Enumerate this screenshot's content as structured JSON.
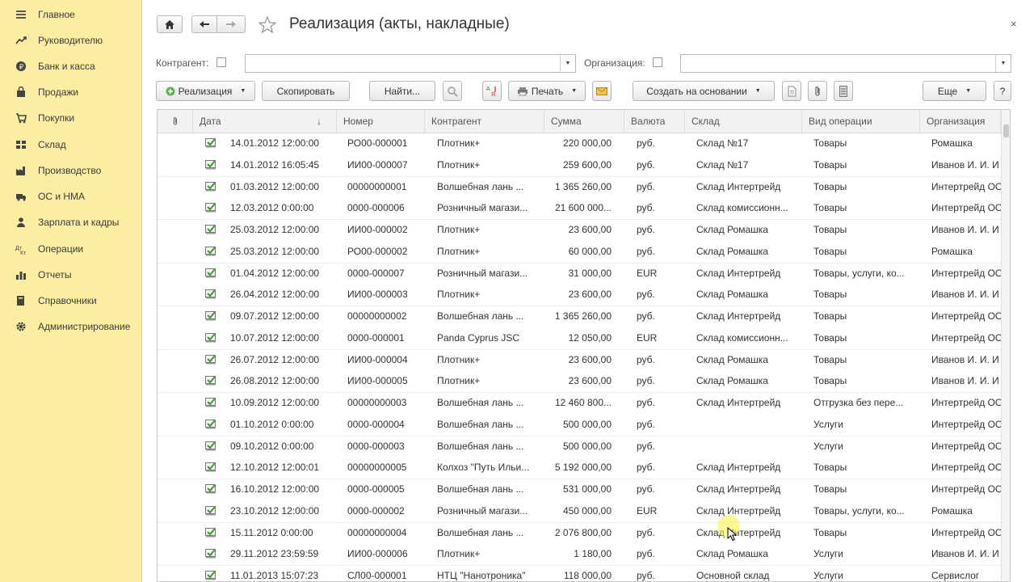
{
  "sidebar": {
    "items": [
      {
        "label": "Главное",
        "icon": "menu-icon"
      },
      {
        "label": "Руководителю",
        "icon": "trend-icon"
      },
      {
        "label": "Банк и касса",
        "icon": "coin-icon"
      },
      {
        "label": "Продажи",
        "icon": "bag-icon"
      },
      {
        "label": "Покупки",
        "icon": "cart-icon"
      },
      {
        "label": "Склад",
        "icon": "warehouse-icon"
      },
      {
        "label": "Производство",
        "icon": "factory-icon"
      },
      {
        "label": "ОС и НМА",
        "icon": "truck-icon"
      },
      {
        "label": "Зарплата и кадры",
        "icon": "person-icon"
      },
      {
        "label": "Операции",
        "icon": "operations-icon"
      },
      {
        "label": "Отчеты",
        "icon": "chart-icon"
      },
      {
        "label": "Справочники",
        "icon": "book-icon"
      },
      {
        "label": "Администрирование",
        "icon": "gear-icon"
      }
    ]
  },
  "header": {
    "title": "Реализация (акты, накладные)",
    "close": "×"
  },
  "filters": {
    "counterparty_label": "Контрагент:",
    "counterparty_value": "",
    "organization_label": "Организация:",
    "organization_value": ""
  },
  "toolbar": {
    "realization": "Реализация",
    "copy": "Скопировать",
    "find": "Найти...",
    "print": "Печать",
    "create_based": "Создать на основании",
    "more": "Еще",
    "help": "?"
  },
  "table": {
    "columns": [
      "Дата",
      "Номер",
      "Контрагент",
      "Сумма",
      "Валюта",
      "Склад",
      "Вид операции",
      "Организация"
    ],
    "sort_indicator": "↓",
    "rows": [
      [
        "14.01.2012 12:00:00",
        "РО00-000001",
        "Плотник+",
        "220 000,00",
        "руб.",
        "Склад №17",
        "Товары",
        "Ромашка"
      ],
      [
        "14.01.2012 16:05:45",
        "ИИ00-000007",
        "Плотник+",
        "259 600,00",
        "руб.",
        "Склад №17",
        "Товары",
        "Иванов И. И. И"
      ],
      [
        "01.03.2012 12:00:00",
        "00000000001",
        "Волшебная лань ...",
        "1 365 260,00",
        "руб.",
        "Склад Интертрейд",
        "Товары",
        "Интертрейд ОО"
      ],
      [
        "12.03.2012 0:00:00",
        "0000-000006",
        "Розничный магази...",
        "21 600 000...",
        "руб.",
        "Склад комиссионн...",
        "Товары",
        "Интертрейд ОО"
      ],
      [
        "25.03.2012 12:00:00",
        "ИИ00-000002",
        "Плотник+",
        "23 600,00",
        "руб.",
        "Склад Ромашка",
        "Товары",
        "Иванов И. И. И"
      ],
      [
        "25.03.2012 12:00:00",
        "РО00-000002",
        "Плотник+",
        "60 000,00",
        "руб.",
        "Склад Ромашка",
        "Товары",
        "Ромашка"
      ],
      [
        "01.04.2012 12:00:00",
        "0000-000007",
        "Розничный магази...",
        "31 000,00",
        "EUR",
        "Склад Интертрейд",
        "Товары, услуги, ко...",
        "Интертрейд ОО"
      ],
      [
        "26.04.2012 12:00:00",
        "ИИ00-000003",
        "Плотник+",
        "23 600,00",
        "руб.",
        "Склад Ромашка",
        "Товары",
        "Иванов И. И. И"
      ],
      [
        "09.07.2012 12:00:00",
        "00000000002",
        "Волшебная лань ...",
        "1 365 260,00",
        "руб.",
        "Склад Интертрейд",
        "Товары",
        "Интертрейд ОО"
      ],
      [
        "10.07.2012 12:00:00",
        "0000-000001",
        "Panda Cyprus JSC",
        "12 050,00",
        "EUR",
        "Склад комиссионн...",
        "Товары",
        "Интертрейд ОО"
      ],
      [
        "26.07.2012 12:00:00",
        "ИИ00-000004",
        "Плотник+",
        "23 600,00",
        "руб.",
        "Склад Ромашка",
        "Товары",
        "Иванов И. И. И"
      ],
      [
        "26.08.2012 12:00:00",
        "ИИ00-000005",
        "Плотник+",
        "23 600,00",
        "руб.",
        "Склад Ромашка",
        "Товары",
        "Иванов И. И. И"
      ],
      [
        "10.09.2012 12:00:00",
        "00000000003",
        "Волшебная лань ...",
        "12 460 800...",
        "руб.",
        "Склад Интертрейд",
        "Отгрузка без пере...",
        "Интертрейд ОО"
      ],
      [
        "01.10.2012 0:00:00",
        "0000-000004",
        "Волшебная лань ...",
        "500 000,00",
        "руб.",
        "",
        "Услуги",
        "Интертрейд ОО"
      ],
      [
        "09.10.2012 0:00:00",
        "0000-000003",
        "Волшебная лань ...",
        "500 000,00",
        "руб.",
        "",
        "Услуги",
        "Интертрейд ОО"
      ],
      [
        "12.10.2012 12:00:01",
        "00000000005",
        "Колхоз \"Путь Ильи...",
        "5 192 000,00",
        "руб.",
        "Склад Интертрейд",
        "Товары",
        "Интертрейд ОО"
      ],
      [
        "16.10.2012 12:00:00",
        "0000-000005",
        "Волшебная лань ...",
        "531 000,00",
        "руб.",
        "Склад Интертрейд",
        "Товары",
        "Интертрейд ОО"
      ],
      [
        "23.10.2012 12:00:00",
        "0000-000002",
        "Розничный магази...",
        "450 000,00",
        "EUR",
        "Склад Интертрейд",
        "Товары, услуги, ко...",
        "Ромашка"
      ],
      [
        "15.11.2012 0:00:00",
        "00000000004",
        "Волшебная лань ...",
        "2 076 800,00",
        "руб.",
        "Склад Интертрейд",
        "Товары",
        "Интертрейд ОО"
      ],
      [
        "29.11.2012 23:59:59",
        "ИИ00-000006",
        "Плотник+",
        "1 180,00",
        "руб.",
        "Склад Ромашка",
        "Услуги",
        "Иванов И. И. И"
      ],
      [
        "11.01.2013 15:07:23",
        "СЛ00-000001",
        "НТЦ \"Нанотроника\"",
        "118 000,00",
        "руб.",
        "Основной склад",
        "Услуги",
        "Сервислог"
      ]
    ]
  },
  "colors": {
    "sidebar_bg": "#fbeea3",
    "doc_icon_green": "#5aa23a",
    "cursor_highlight": "#fff03c"
  }
}
